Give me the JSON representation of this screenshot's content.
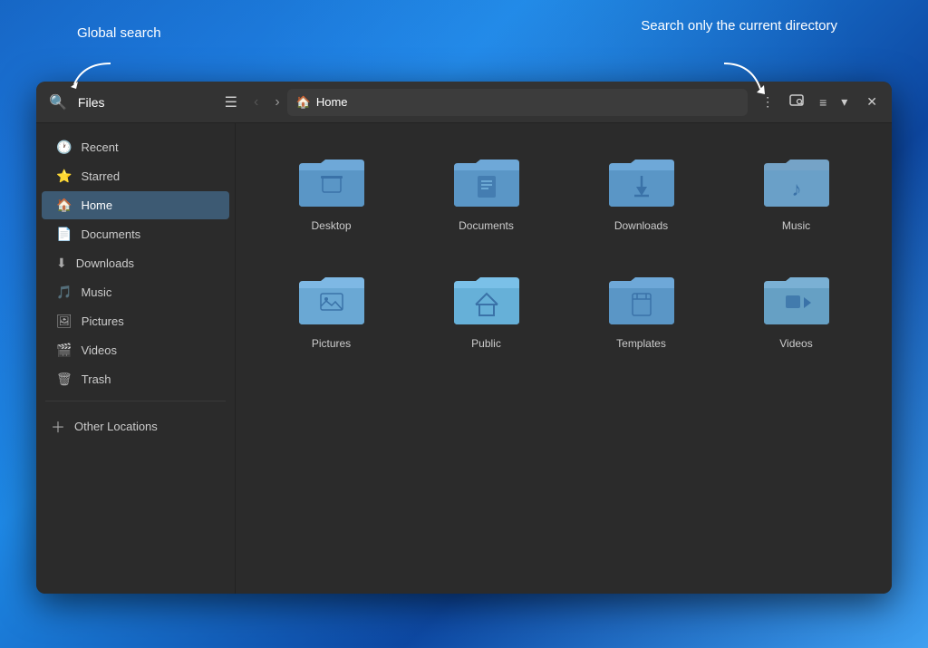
{
  "annotations": {
    "global_search": "Global search",
    "search_directory": "Search only the current directory"
  },
  "window": {
    "title": "Files",
    "location": "Home",
    "location_icon": "🏠"
  },
  "sidebar": {
    "items": [
      {
        "id": "recent",
        "label": "Recent",
        "icon": "🕐",
        "active": false
      },
      {
        "id": "starred",
        "label": "Starred",
        "icon": "⭐",
        "active": false
      },
      {
        "id": "home",
        "label": "Home",
        "icon": "🏠",
        "active": true
      },
      {
        "id": "documents",
        "label": "Documents",
        "icon": "📄",
        "active": false
      },
      {
        "id": "downloads",
        "label": "Downloads",
        "icon": "⬇",
        "active": false
      },
      {
        "id": "music",
        "label": "Music",
        "icon": "🎵",
        "active": false
      },
      {
        "id": "pictures",
        "label": "Pictures",
        "icon": "🖼",
        "active": false
      },
      {
        "id": "videos",
        "label": "Videos",
        "icon": "🎬",
        "active": false
      },
      {
        "id": "trash",
        "label": "Trash",
        "icon": "🗑",
        "active": false
      }
    ],
    "other_locations": "Other Locations"
  },
  "folders": [
    {
      "id": "desktop",
      "label": "Desktop",
      "icon_type": "folder-generic"
    },
    {
      "id": "documents",
      "label": "Documents",
      "icon_type": "folder-documents"
    },
    {
      "id": "downloads",
      "label": "Downloads",
      "icon_type": "folder-downloads"
    },
    {
      "id": "music",
      "label": "Music",
      "icon_type": "folder-music"
    },
    {
      "id": "pictures",
      "label": "Pictures",
      "icon_type": "folder-pictures"
    },
    {
      "id": "public",
      "label": "Public",
      "icon_type": "folder-public"
    },
    {
      "id": "templates",
      "label": "Templates",
      "icon_type": "folder-templates"
    },
    {
      "id": "videos",
      "label": "Videos",
      "icon_type": "folder-videos"
    }
  ],
  "colors": {
    "folder_body": "#6ea8d8",
    "folder_tab": "#89c0e8",
    "folder_dark": "#5090c0",
    "icon_color": "#3a72a8"
  }
}
